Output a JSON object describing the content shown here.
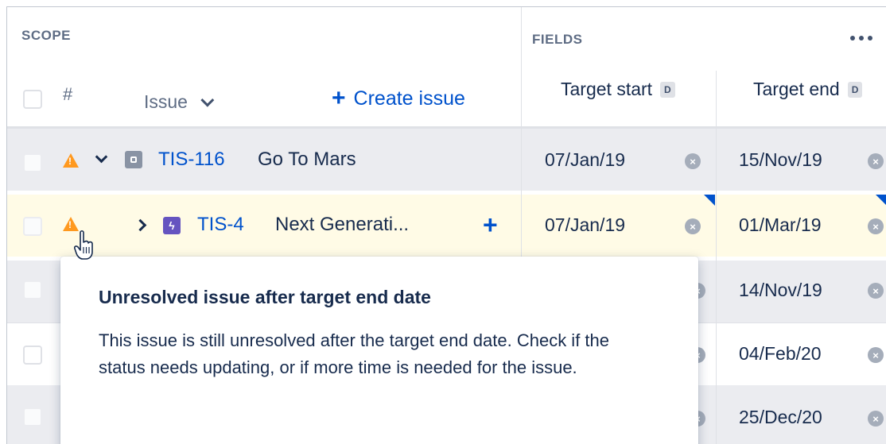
{
  "header": {
    "scope_label": "SCOPE",
    "fields_label": "FIELDS",
    "hash_label": "#",
    "issue_label": "Issue",
    "create_issue_label": "Create issue",
    "target_start_label": "Target start",
    "target_end_label": "Target end",
    "date_badge": "D"
  },
  "rows": [
    {
      "key": "TIS-116",
      "summary": "Go To Mars",
      "target_start": "07/Jan/19",
      "target_end": "15/Nov/19",
      "warning": true,
      "type_icon": "initiative-icon",
      "expanded": true
    },
    {
      "key": "TIS-4",
      "summary": "Next Generati...",
      "target_start": "07/Jan/19",
      "target_end": "01/Mar/19",
      "warning": true,
      "type_icon": "epic-icon",
      "expanded": false
    },
    {
      "target_end": "14/Nov/19"
    },
    {
      "target_end": "04/Feb/20"
    },
    {
      "target_end": "25/Dec/20"
    }
  ],
  "tooltip": {
    "title": "Unresolved issue after target end date",
    "body": "This issue is still unresolved after the target end date. Check if the status needs updating, or if more time is needed for the issue."
  },
  "colors": {
    "link": "#0052cc",
    "warning": "#ff991f",
    "row_highlight": "#fffbe6",
    "row_gray": "#ebecf0",
    "epic": "#6554c0"
  }
}
